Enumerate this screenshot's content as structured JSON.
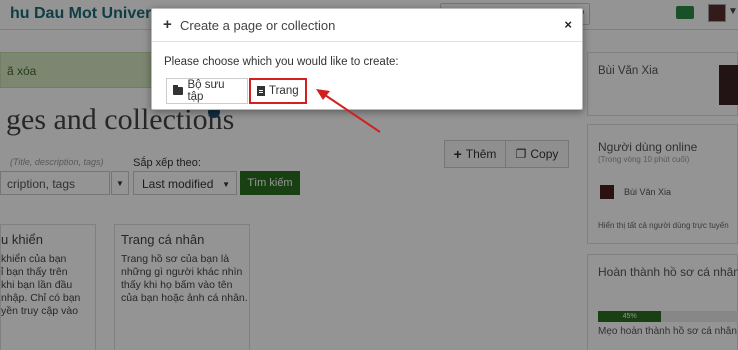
{
  "header": {
    "brand": "hu Dau Mot Univers",
    "search_icon": "magnifier-icon",
    "mail_icon": "envelope-icon"
  },
  "alert": {
    "text": "ã xóa"
  },
  "page": {
    "heading": "ges and collections",
    "add_label": "Thêm",
    "copy_label": "Copy"
  },
  "search": {
    "hint": "(Title, description, tags)",
    "value": "cription, tags",
    "sort_label": "Sắp xếp theo:",
    "sort_value": "Last modified",
    "submit_label": "Tìm kiếm"
  },
  "cards": [
    {
      "title": "u khiển",
      "body": [
        "khiển của bạn",
        "ỉ bạn thấy trên",
        "khi bạn lần đầu",
        "nhập. Chỉ có bạn",
        "yền truy cập vào"
      ]
    },
    {
      "title": "Trang cá nhân",
      "body": [
        "Trang hồ sơ của bạn là",
        "những gì người khác nhìn",
        "thấy khi họ bấm vào tên",
        "của bạn hoặc ảnh cá nhân."
      ]
    }
  ],
  "sidebar": {
    "user_name": "Bùi Văn Xia",
    "online_title": "Người dùng online",
    "online_sub": "(Trong vòng 10 phút cuối)",
    "online_user": "Bùi Văn Xia",
    "online_all": "Hiển thị tất cả người dùng trực tuyến",
    "profile_title": "Hoàn thành hồ sơ cá nhân",
    "progress_label": "45%",
    "progress_value": 45,
    "profile_tip": "Mẹo hoàn thành hồ sơ cá nhân"
  },
  "modal": {
    "title": "Create a page or collection",
    "close_label": "×",
    "prompt": "Please choose which you would like to create:",
    "option_collection": "Bộ sưu tập",
    "option_page": "Trang"
  },
  "colors": {
    "accent_green": "#2a6e1f",
    "highlight_red": "#d21f1f",
    "brand_teal": "#1c6b78"
  }
}
